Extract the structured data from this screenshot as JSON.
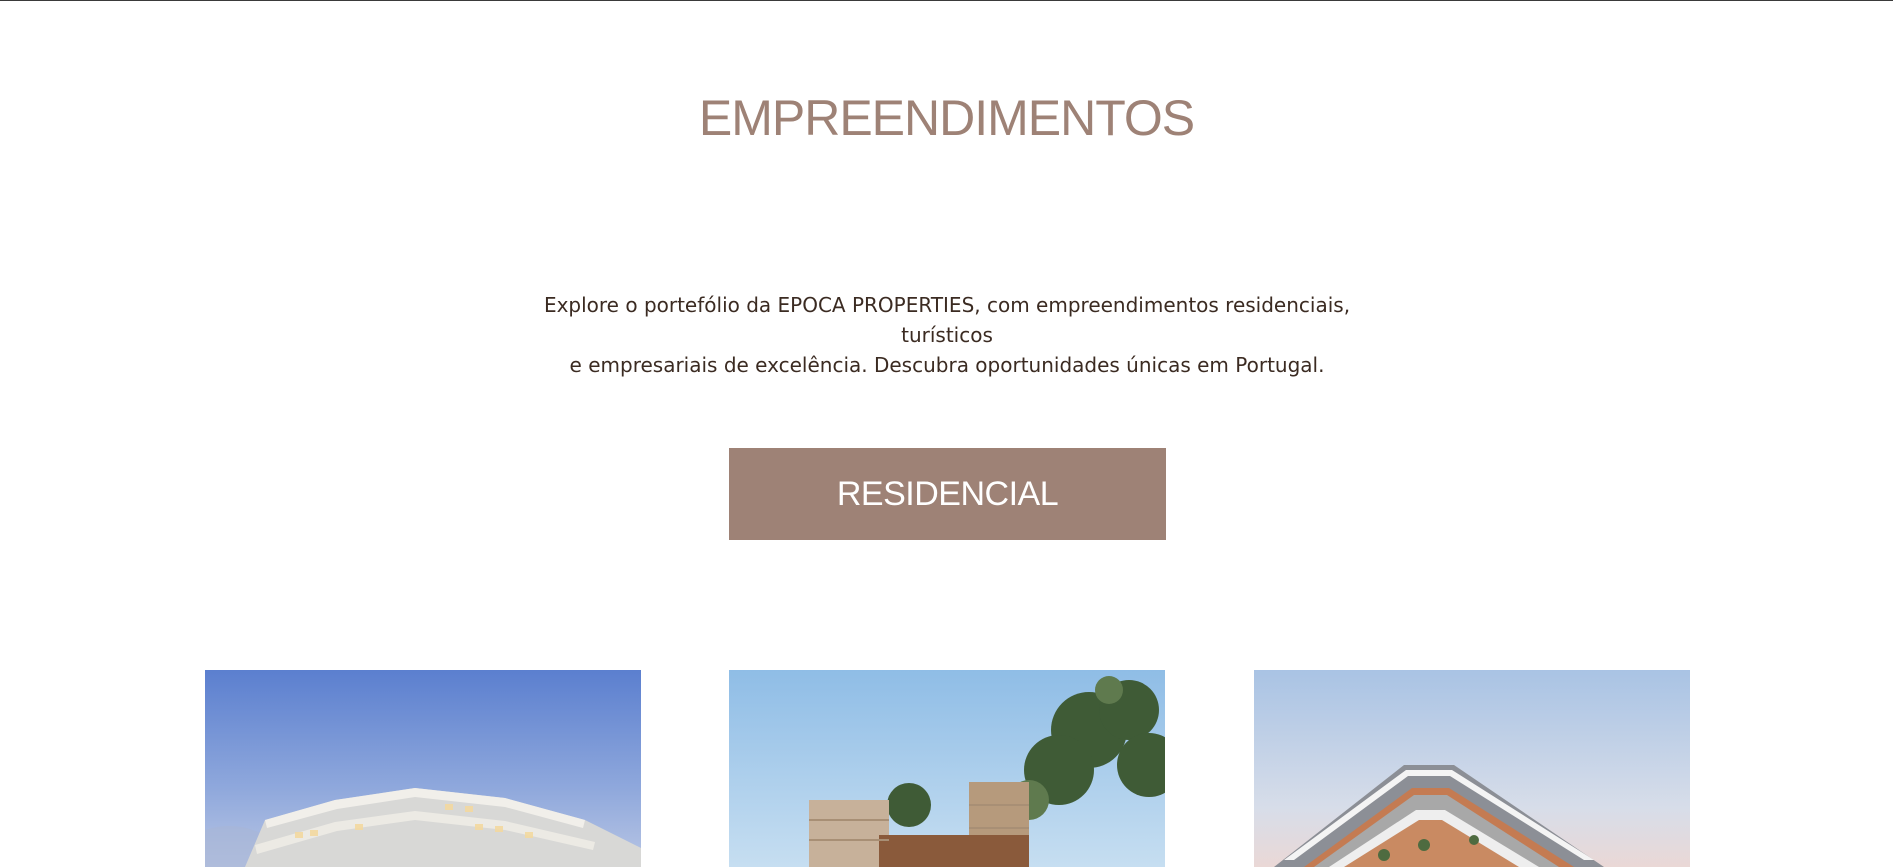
{
  "section": {
    "title": "EMPREENDIMENTOS",
    "intro_line_1": "Explore o portefólio da EPOCA PROPERTIES, com empreendimentos residenciais, turísticos",
    "intro_line_2": "e empresariais de excelência. Descubra oportunidades únicas em Portugal."
  },
  "category_button": {
    "label": "RESIDENCIAL"
  },
  "colors": {
    "accent": "#9e8276",
    "text": "#3b2b22",
    "background": "#ffffff"
  },
  "projects": [
    {
      "image": "modern-white-apartment-building-blue-sky"
    },
    {
      "image": "wood-and-stone-building-with-trees"
    },
    {
      "image": "angular-building-at-dusk"
    }
  ]
}
